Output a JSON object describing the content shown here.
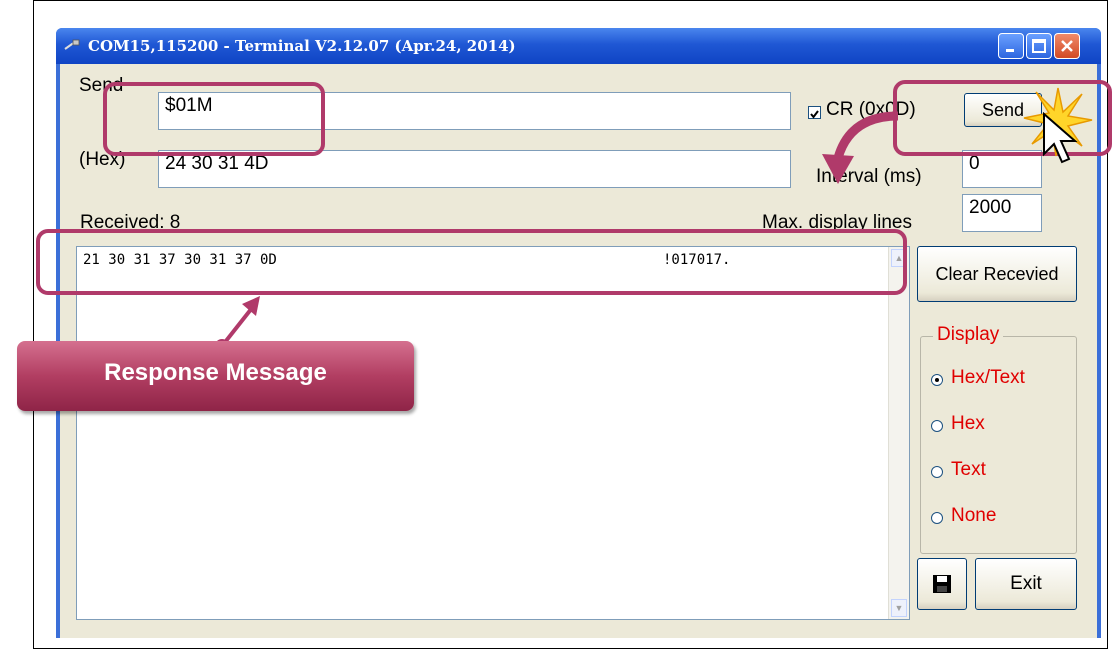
{
  "window": {
    "title": "COM15,115200 - Terminal V2.12.07 (Apr.24, 2014)",
    "title_icon": "plug-icon",
    "controls": [
      "minimize-icon",
      "maximize-icon",
      "close-icon"
    ]
  },
  "send": {
    "label": "Send",
    "value": "$01M",
    "hex_label": "(Hex)",
    "hex_value": "24 30 31 4D",
    "cr_label": "CR (0x0D)",
    "cr_checked": true,
    "button_label": "Send"
  },
  "interval": {
    "label": "Interval (ms)",
    "value": "0"
  },
  "max_lines": {
    "label": "Max. display lines",
    "value": "2000"
  },
  "received": {
    "label": "Received: 8",
    "hex_line": "21 30 31 37 30 31 37 0D",
    "text_line": "!017017."
  },
  "clear_button": "Clear Recevied",
  "display": {
    "title": "Display",
    "options": [
      "Hex/Text",
      "Hex",
      "Text",
      "None"
    ],
    "selected": "Hex/Text"
  },
  "save_icon": "floppy-disk-icon",
  "exit_button": "Exit",
  "callout": {
    "label": "Response Message"
  },
  "colors": {
    "highlight": "#b03a6a",
    "display_red": "#e00000"
  }
}
